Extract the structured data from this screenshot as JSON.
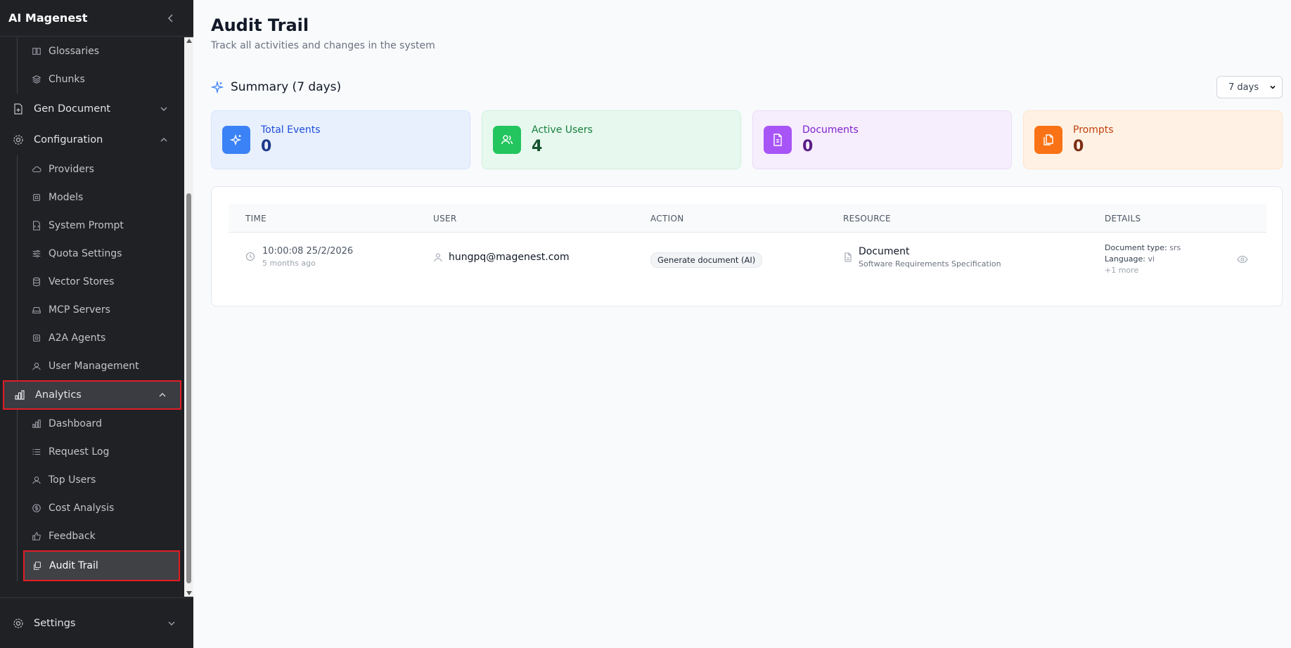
{
  "sidebar": {
    "brand": "AI Magenest",
    "items": {
      "glossaries": "Glossaries",
      "chunks": "Chunks",
      "gen_document": "Gen Document",
      "configuration": "Configuration",
      "providers": "Providers",
      "models": "Models",
      "system_prompt": "System Prompt",
      "quota_settings": "Quota Settings",
      "vector_stores": "Vector Stores",
      "mcp_servers": "MCP Servers",
      "a2a_agents": "A2A Agents",
      "user_management": "User Management",
      "analytics": "Analytics",
      "dashboard": "Dashboard",
      "request_log": "Request Log",
      "top_users": "Top Users",
      "cost_analysis": "Cost Analysis",
      "feedback": "Feedback",
      "audit_trail": "Audit Trail"
    },
    "footer": {
      "settings": "Settings"
    }
  },
  "main": {
    "title": "Audit Trail",
    "subtitle": "Track all activities and changes in the system",
    "summary_title": "Summary (7 days)",
    "period": {
      "selected": "7 days"
    },
    "stats": [
      {
        "label": "Total Events",
        "value": "0",
        "bg": "#e8f0fe",
        "border": "#d6e4fb",
        "icon_bg": "#3b82f6",
        "text": "#1d4ed8",
        "value_color": "#1e3a8a",
        "icon": "sparkles-icon"
      },
      {
        "label": "Active Users",
        "value": "4",
        "bg": "#e7f8ee",
        "border": "#d1f1de",
        "icon_bg": "#22c55e",
        "text": "#15803d",
        "value_color": "#14532d",
        "icon": "users-icon"
      },
      {
        "label": "Documents",
        "value": "0",
        "bg": "#f6edfd",
        "border": "#ecdcfb",
        "icon_bg": "#a855f7",
        "text": "#7e22ce",
        "value_color": "#581c87",
        "icon": "document-icon"
      },
      {
        "label": "Prompts",
        "value": "0",
        "bg": "#fff2e5",
        "border": "#fde4cc",
        "icon_bg": "#f97316",
        "text": "#c2410c",
        "value_color": "#7c2d12",
        "icon": "copy-icon"
      }
    ],
    "table": {
      "columns": [
        "TIME",
        "USER",
        "ACTION",
        "RESOURCE",
        "DETAILS"
      ],
      "rows": [
        {
          "time": "10:00:08 25/2/2026",
          "relative": "5 months ago",
          "user": "hungpq@magenest.com",
          "action": "Generate document (AI)",
          "resource": "Document",
          "resource_sub": "Software Requirements Specification",
          "details": {
            "doc_type_label": "Document type:",
            "doc_type_value": "srs",
            "language_label": "Language:",
            "language_value": "vi",
            "more": "+1 more"
          }
        }
      ]
    }
  }
}
